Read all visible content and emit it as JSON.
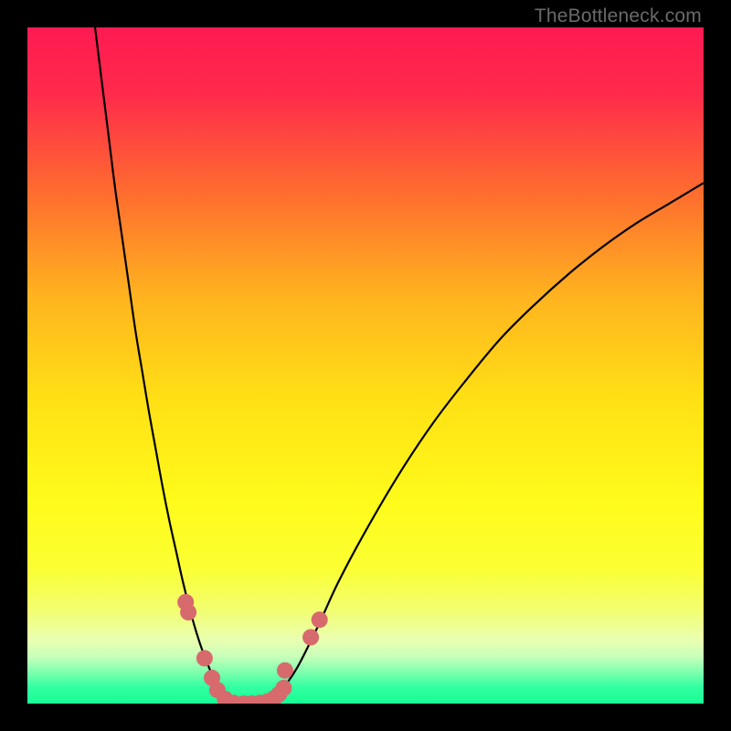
{
  "watermark": "TheBottleneck.com",
  "chart_data": {
    "type": "line",
    "title": "",
    "xlabel": "",
    "ylabel": "",
    "xlim": [
      0,
      100
    ],
    "ylim": [
      0,
      100
    ],
    "grid": false,
    "legend": false,
    "gradient_stops": [
      {
        "pos": 0.0,
        "color": "#ff1a52"
      },
      {
        "pos": 0.1,
        "color": "#ff2b4b"
      },
      {
        "pos": 0.25,
        "color": "#ff6f2e"
      },
      {
        "pos": 0.4,
        "color": "#ffb41f"
      },
      {
        "pos": 0.55,
        "color": "#ffe015"
      },
      {
        "pos": 0.7,
        "color": "#fffb1a"
      },
      {
        "pos": 0.8,
        "color": "#fbff33"
      },
      {
        "pos": 0.86,
        "color": "#f2ff6e"
      },
      {
        "pos": 0.905,
        "color": "#eaffb0"
      },
      {
        "pos": 0.93,
        "color": "#c9ffba"
      },
      {
        "pos": 0.955,
        "color": "#7affae"
      },
      {
        "pos": 0.975,
        "color": "#33ffa1"
      },
      {
        "pos": 1.0,
        "color": "#16ff95"
      }
    ],
    "series": [
      {
        "name": "left-curve",
        "stroke": "#000000",
        "points": [
          [
            10,
            100
          ],
          [
            11,
            92
          ],
          [
            12,
            84
          ],
          [
            13,
            76
          ],
          [
            14,
            69
          ],
          [
            15,
            62
          ],
          [
            16,
            55
          ],
          [
            17,
            49
          ],
          [
            18,
            43
          ],
          [
            19,
            37.5
          ],
          [
            20,
            32
          ],
          [
            21,
            27
          ],
          [
            22,
            22.5
          ],
          [
            23,
            18
          ],
          [
            24,
            14
          ],
          [
            25,
            10.5
          ],
          [
            26,
            7.5
          ],
          [
            27,
            5
          ],
          [
            28,
            3
          ],
          [
            29,
            1.3
          ],
          [
            30,
            0.3
          ],
          [
            31,
            0
          ]
        ]
      },
      {
        "name": "right-curve",
        "stroke": "#000000",
        "points": [
          [
            35,
            0
          ],
          [
            36,
            0.3
          ],
          [
            37,
            1.2
          ],
          [
            38,
            2.5
          ],
          [
            40,
            5.5
          ],
          [
            43,
            11.5
          ],
          [
            46,
            18
          ],
          [
            50,
            25.5
          ],
          [
            55,
            34
          ],
          [
            60,
            41.5
          ],
          [
            65,
            48
          ],
          [
            70,
            54
          ],
          [
            75,
            59
          ],
          [
            80,
            63.5
          ],
          [
            85,
            67.5
          ],
          [
            90,
            71
          ],
          [
            95,
            74
          ],
          [
            100,
            77
          ]
        ]
      },
      {
        "name": "pink-dots-left",
        "stroke": "#d76a6d",
        "type": "scatter",
        "points": [
          [
            23.4,
            15.0
          ],
          [
            23.8,
            13.5
          ],
          [
            26.2,
            6.7
          ],
          [
            27.3,
            3.8
          ],
          [
            28.1,
            2.0
          ],
          [
            29.2,
            0.7
          ],
          [
            30.5,
            0.1
          ]
        ]
      },
      {
        "name": "pink-dots-right",
        "stroke": "#d76a6d",
        "type": "scatter",
        "points": [
          [
            32.0,
            0.0
          ],
          [
            33.2,
            0.0
          ],
          [
            34.4,
            0.1
          ],
          [
            35.5,
            0.3
          ],
          [
            36.5,
            0.8
          ],
          [
            37.2,
            1.4
          ],
          [
            37.9,
            2.3
          ],
          [
            38.1,
            4.9
          ],
          [
            41.9,
            9.8
          ],
          [
            43.2,
            12.4
          ]
        ]
      }
    ]
  }
}
